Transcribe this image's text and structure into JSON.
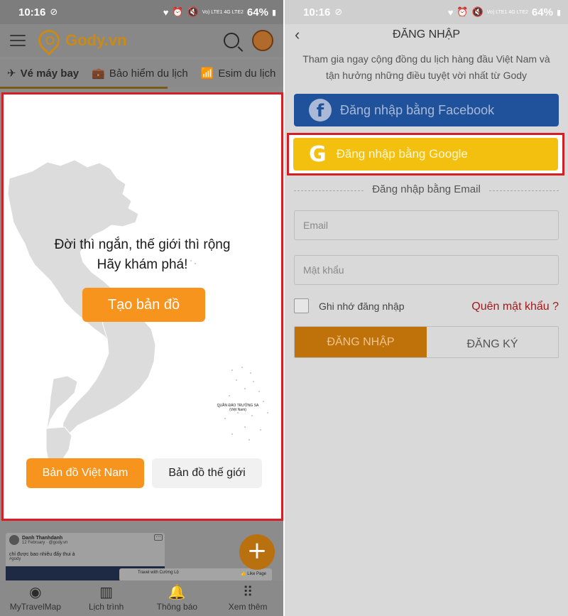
{
  "status_left": {
    "time": "10:16",
    "signal_text": "Vo) LTE1 4G LTE2",
    "battery": "64%"
  },
  "status_right": {
    "time": "10:16",
    "signal_text": "Vo) LTE1 4G LTE2",
    "battery": "64%"
  },
  "header": {
    "brand": "Gody.vn"
  },
  "tabs": [
    {
      "label": "Vé máy bay",
      "icon": "airplane-icon"
    },
    {
      "label": "Bảo hiểm du lịch",
      "icon": "briefcase-icon"
    },
    {
      "label": "Esim du lịch",
      "icon": "wifi-icon"
    }
  ],
  "map_card": {
    "headline_line1": "Đời thì ngắn, thế giới thì rộng",
    "headline_line2": "Hãy khám phá!",
    "create_button": "Tạo bản đồ",
    "vietnam_map_button": "Bản đồ Việt Nam",
    "world_map_button": "Bản đồ thế giới",
    "island_label_1": "QUẦN ĐẢO TRƯỜNG SA",
    "island_label_2": "(Việt Nam)"
  },
  "feed": {
    "author": "Danh Thanhdanh",
    "date": "12 February · @gody.vn",
    "text": "chỉ được bao nhiêu đấy thui à",
    "tag": "#gody",
    "more": "···",
    "author2": "Travel with Cường Lộ",
    "like": "👍 Like Page",
    "fab": "+"
  },
  "bottom_nav": [
    {
      "label": "MyTravelMap",
      "icon": "map-pin-icon"
    },
    {
      "label": "Lịch trình",
      "icon": "map-icon"
    },
    {
      "label": "Thông báo",
      "icon": "bell-icon"
    },
    {
      "label": "Xem thêm",
      "icon": "grid-icon"
    }
  ],
  "login": {
    "title": "ĐĂNG NHẬP",
    "subtitle_line1": "Tham gia ngay cộng đồng du lịch hàng đầu Việt Nam và",
    "subtitle_line2": "tận hưởng những điều tuyệt vời nhất từ Gody",
    "facebook_button": "Đăng nhập bằng Facebook",
    "google_button": "Đăng nhập bằng Google",
    "email_separator": "Đăng nhập bằng Email",
    "email_placeholder": "Email",
    "password_placeholder": "Mật khẩu",
    "remember_label": "Ghi nhớ đăng nhập",
    "forgot_link": "Quên mật khẩu ?",
    "login_tab": "ĐĂNG NHẬP",
    "register_tab": "ĐĂNG KÝ"
  },
  "colors": {
    "accent_orange": "#f7941d",
    "highlight_red": "#d41f26",
    "facebook_blue": "#20529c",
    "google_yellow": "#f3c010"
  }
}
